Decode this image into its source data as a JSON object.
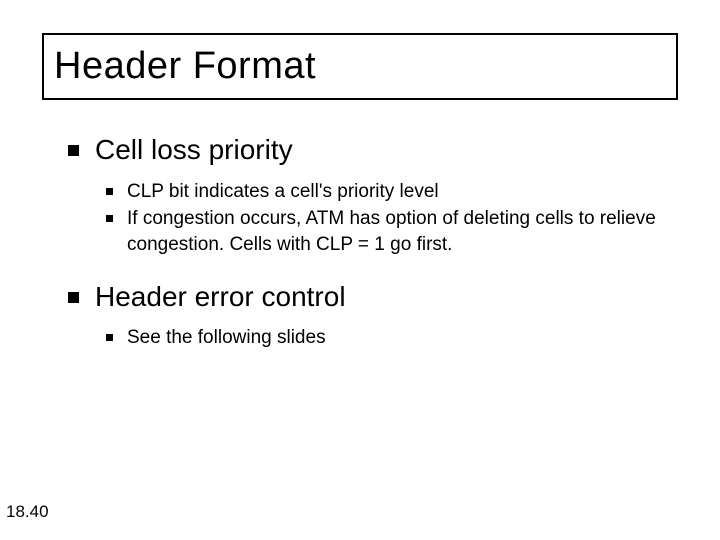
{
  "title": "Header Format",
  "sections": [
    {
      "heading": "Cell loss priority",
      "items": [
        "CLP bit indicates a cell's priority level",
        "If congestion occurs, ATM has option of deleting cells to relieve congestion.  Cells with CLP = 1 go first."
      ]
    },
    {
      "heading": "Header error control",
      "items": [
        "See the following slides"
      ]
    }
  ],
  "page_number": "18.40"
}
